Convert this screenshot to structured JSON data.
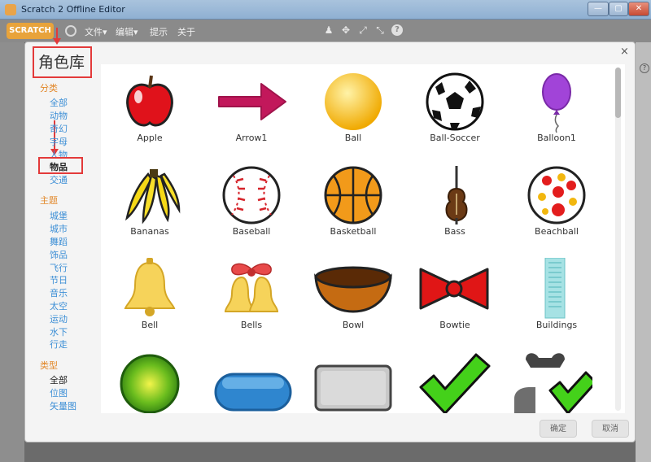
{
  "window": {
    "title": "Scratch 2 Offline Editor",
    "min_label": "—",
    "max_label": "▢",
    "close_label": "✕"
  },
  "menubar": {
    "logo": "SCRATCH",
    "items": [
      "文件▾",
      "编辑▾",
      "提示",
      "关于"
    ]
  },
  "dialog": {
    "title": "角色库",
    "close_label": "×",
    "categories": {
      "heading": "分类",
      "items": [
        "全部",
        "动物",
        "奇幻",
        "字母",
        "人物",
        "物品",
        "交通"
      ],
      "selected": "物品"
    },
    "themes": {
      "heading": "主题",
      "items": [
        "城堡",
        "城市",
        "舞蹈",
        "饰品",
        "飞行",
        "节日",
        "音乐",
        "太空",
        "运动",
        "水下",
        "行走"
      ]
    },
    "types": {
      "heading": "类型",
      "items": [
        "全部",
        "位图",
        "矢量图"
      ],
      "selected": "全部"
    },
    "sprites": [
      "Apple",
      "Arrow1",
      "Ball",
      "Ball-Soccer",
      "Balloon1",
      "Bananas",
      "Baseball",
      "Basketball",
      "Bass",
      "Beachball",
      "Bell",
      "Bells",
      "Bowl",
      "Bowtie",
      "Buildings",
      "",
      "",
      "",
      "",
      ""
    ],
    "ok_label": "确定",
    "cancel_label": "取消"
  },
  "colors": {
    "highlight": "#e33a3a",
    "category_heading": "#e2882a",
    "category_link": "#3d8fd6"
  }
}
